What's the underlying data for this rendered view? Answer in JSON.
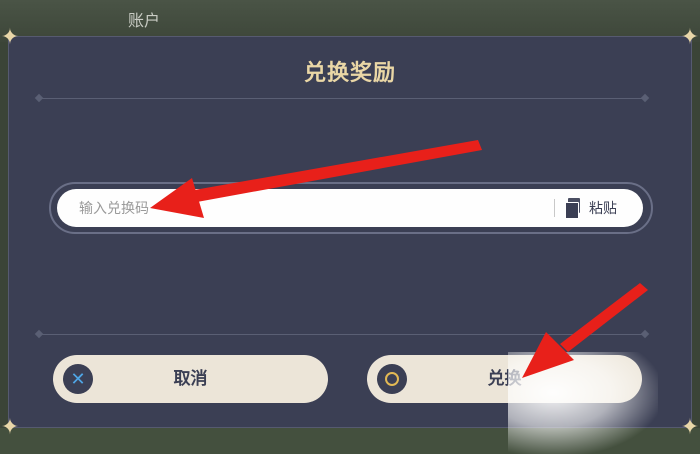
{
  "background": {
    "title": "账户"
  },
  "dialog": {
    "title": "兑换奖励",
    "input": {
      "placeholder": "输入兑换码",
      "value": ""
    },
    "paste": {
      "label": "粘贴",
      "icon": "paste-icon"
    },
    "cancel": {
      "label": "取消",
      "icon": "x-icon",
      "icon_color": "#4fa6e6"
    },
    "redeem": {
      "label": "兑换",
      "icon": "circle-icon",
      "icon_color": "#e2b954"
    }
  },
  "colors": {
    "dialog_bg": "#3b3f54",
    "title_gold": "#ead7a6",
    "button_bg": "#ece5d8",
    "annotation_arrow": "#e8201a"
  }
}
